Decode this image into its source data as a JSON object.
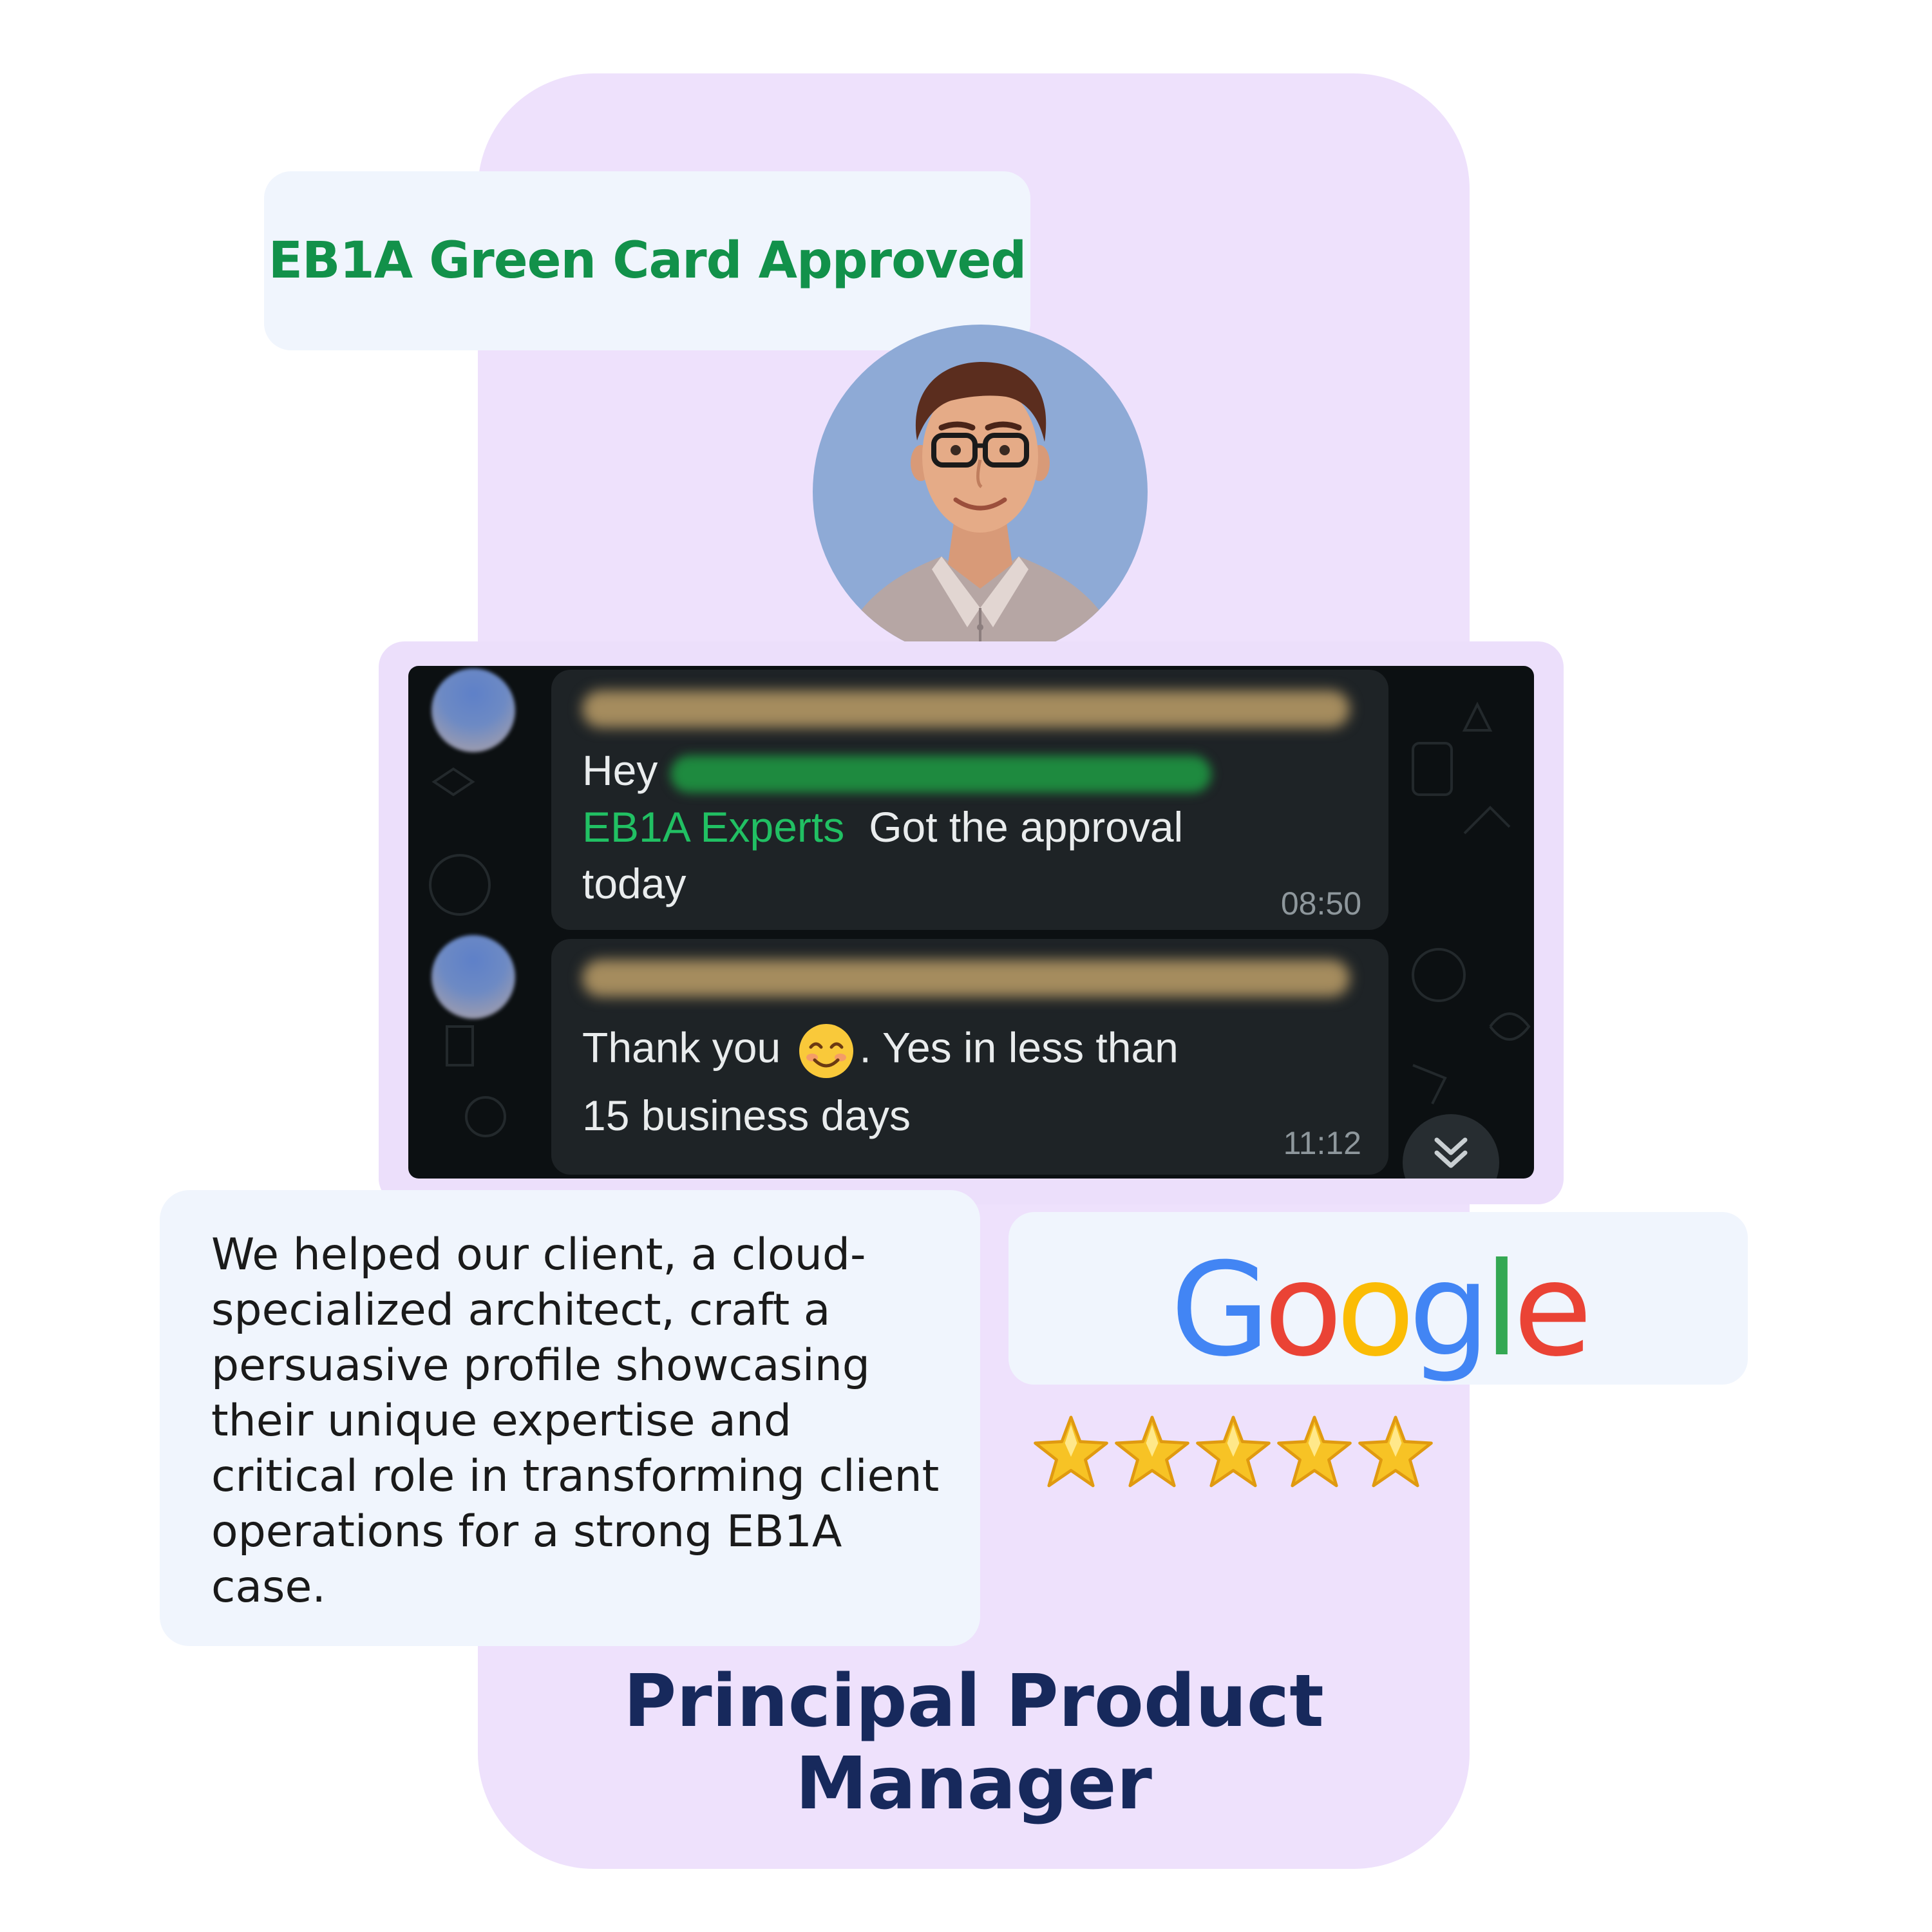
{
  "badge": {
    "label": "EB1A Green Card Approved"
  },
  "chat": {
    "messages": [
      {
        "greeting": "Hey",
        "mention": "EB1A Experts",
        "text_line1_rest": "Got the approval",
        "text_line2": "today",
        "time": "08:50"
      },
      {
        "text_line1_before_emoji": "Thank you",
        "text_line1_after_emoji": ". Yes in less than",
        "text_line2": "15 business days",
        "time": "11:12"
      }
    ]
  },
  "description": "We helped our client, a cloud-specialized architect, craft a persuasive profile showcasing their unique expertise and critical role in transforming client operations for a strong EB1A case.",
  "company": {
    "name_letters": [
      "G",
      "o",
      "o",
      "g",
      "l",
      "e"
    ],
    "letter_colors": [
      "#4285F4",
      "#EA4335",
      "#FBBC05",
      "#4285F4",
      "#34A853",
      "#EA4335"
    ]
  },
  "rating": {
    "stars": 5,
    "max": 5
  },
  "role": {
    "line1": "Principal Product",
    "line2": "Manager"
  },
  "colors": {
    "panel": "#eee1fc",
    "badge_text": "#12914a",
    "role_text": "#17295c",
    "chat_bg": "#0c1012",
    "mention": "#21c063"
  }
}
